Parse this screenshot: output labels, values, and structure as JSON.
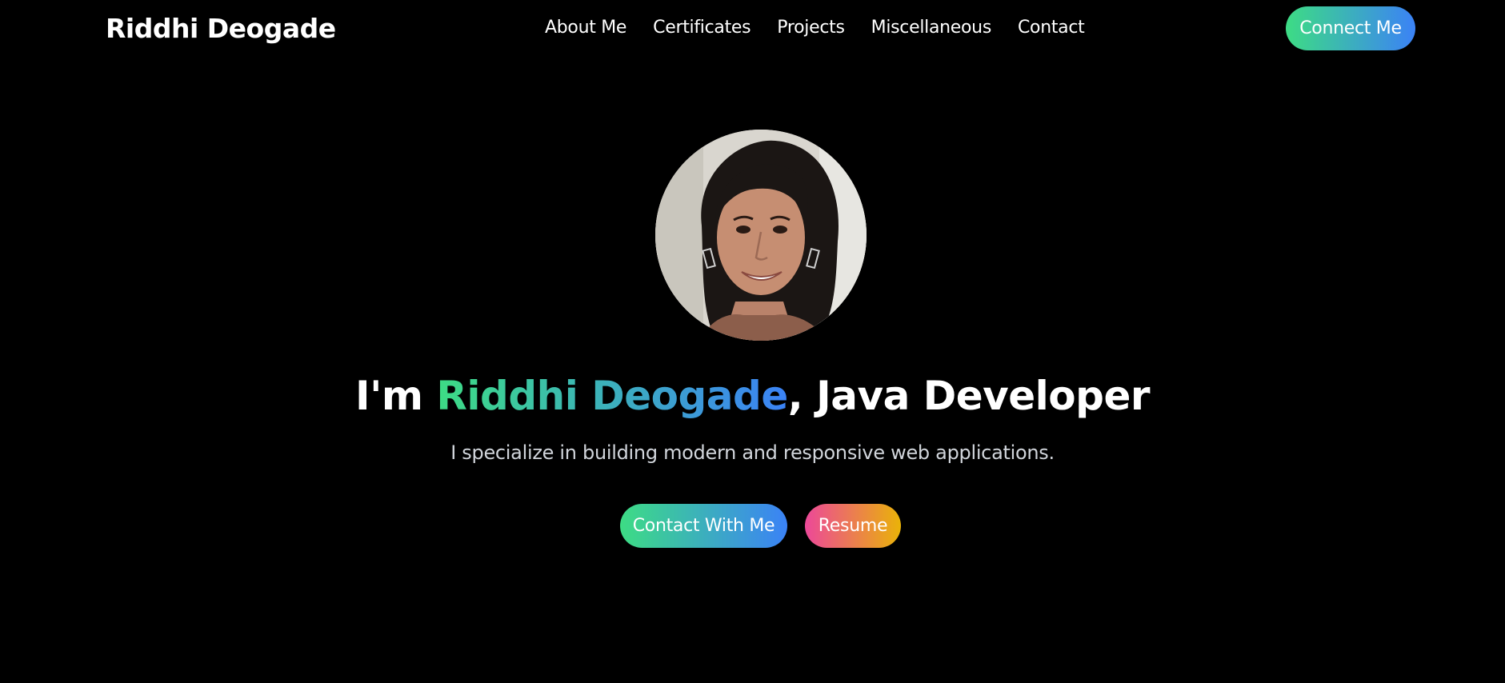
{
  "navbar": {
    "logo": "Riddhi Deogade",
    "links": [
      "About Me",
      "Certificates",
      "Projects",
      "Miscellaneous",
      "Contact"
    ],
    "connect_label": "Connect Me"
  },
  "hero": {
    "avatar_icon": "profile-photo",
    "headline_prefix": "I'm ",
    "headline_name": "Riddhi Deogade",
    "headline_suffix": ", Java Developer",
    "subtitle": "I specialize in building modern and responsive web applications.",
    "contact_label": "Contact With Me",
    "resume_label": "Resume"
  },
  "colors": {
    "background": "#000000",
    "accent_gradient_start": "#3ddc84",
    "accent_gradient_end": "#3b82f6",
    "resume_gradient_start": "#ec4899",
    "resume_gradient_end": "#eab308"
  }
}
